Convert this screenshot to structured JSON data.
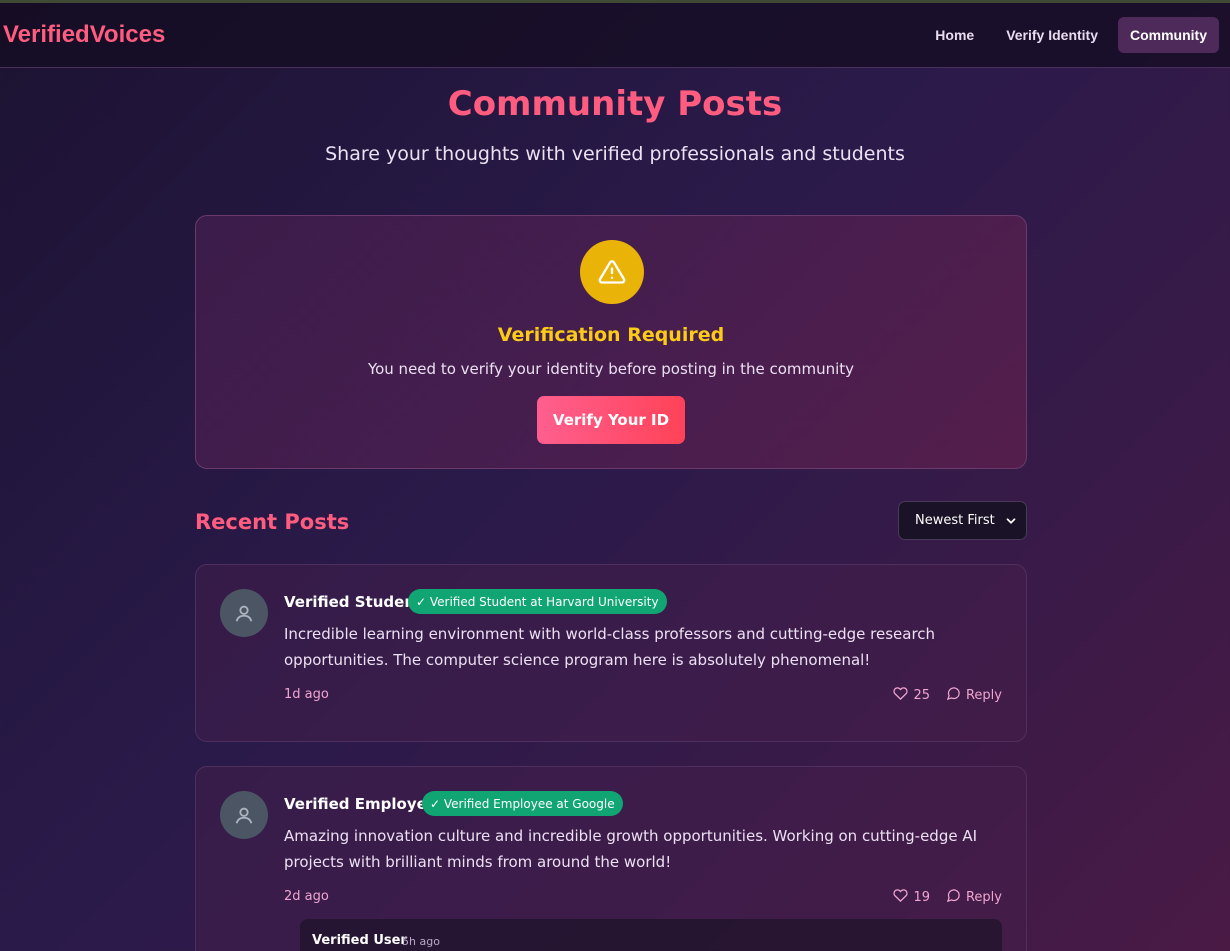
{
  "app": {
    "brand": "VerifiedVoices"
  },
  "nav": {
    "items": [
      {
        "label": "Home",
        "active": false
      },
      {
        "label": "Verify Identity",
        "active": false
      },
      {
        "label": "Community",
        "active": true
      }
    ]
  },
  "hero": {
    "title": "Community Posts",
    "subtitle": "Share your thoughts with verified professionals and students"
  },
  "verification": {
    "icon": "warning-icon",
    "title": "Verification Required",
    "text": "You need to verify your identity before posting in the community",
    "button_label": "Verify Your ID"
  },
  "recent": {
    "title": "Recent Posts",
    "sort_selected": "Newest First"
  },
  "posts": [
    {
      "author": "Verified Student",
      "badge": "✓ Verified Student at Harvard University",
      "body": "Incredible learning environment with world-class professors and cutting-edge research opportunities. The computer science program here is absolutely phenomenal!",
      "time": "1d ago",
      "likes": "25",
      "reply_label": "Reply"
    },
    {
      "author": "Verified Employee",
      "badge": "✓ Verified Employee at Google",
      "body": "Amazing innovation culture and incredible growth opportunities. Working on cutting-edge AI projects with brilliant minds from around the world!",
      "time": "2d ago",
      "likes": "19",
      "reply_label": "Reply",
      "replies": [
        {
          "author": "Verified User",
          "time": "5h ago"
        }
      ]
    }
  ],
  "colors": {
    "accent": "#ff5c7f",
    "warning": "#eab308",
    "badge_green": "#10a572",
    "muted_pink": "#f0a5d0"
  }
}
